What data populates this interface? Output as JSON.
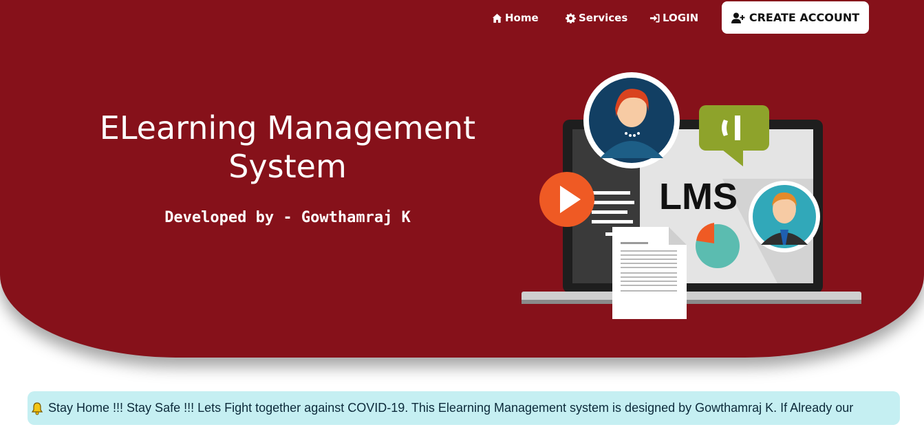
{
  "nav": {
    "home": "Home",
    "services": "Services",
    "login": "LOGIN",
    "create_account": "CREATE ACCOUNT"
  },
  "hero": {
    "title_line1": "ELearning Management",
    "title_line2": "System",
    "subtitle": "Developed by - Gowthamraj K",
    "illustration_label": "LMS"
  },
  "notice": {
    "text": "Stay Home !!! Stay Safe !!! Lets Fight together against COVID-19. This Elearning Management system is designed by Gowthamraj K. If Already our"
  },
  "icons": {
    "home": "home-icon",
    "services": "gear-icon",
    "login": "sign-in-icon",
    "create_account": "user-plus-icon",
    "notice": "bell-icon"
  },
  "colors": {
    "hero_bg": "#86111a",
    "notice_bg": "#c5eff2",
    "play_button": "#ef5a24",
    "chat_bubble": "#8ea32b"
  }
}
